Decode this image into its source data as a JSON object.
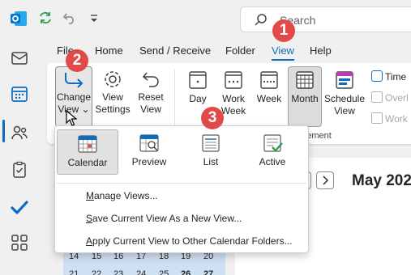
{
  "search": {
    "placeholder": "Search"
  },
  "menu": {
    "tabs": [
      {
        "label": "File"
      },
      {
        "label": "Home"
      },
      {
        "label": "Send / Receive"
      },
      {
        "label": "Folder"
      },
      {
        "label": "View",
        "active": true
      },
      {
        "label": "Help"
      }
    ]
  },
  "ribbon": {
    "change_view": {
      "line1": "Change",
      "line2": "View"
    },
    "view_settings": {
      "line1": "View",
      "line2": "Settings"
    },
    "reset_view": {
      "line1": "Reset",
      "line2": "View"
    },
    "day": "Day",
    "work_week": {
      "line1": "Work",
      "line2": "Week"
    },
    "week": "Week",
    "month": "Month",
    "schedule_view": {
      "line1": "Schedule",
      "line2": "View"
    },
    "time_scale": "Time",
    "overlay": "Overl",
    "work_hours": "Work",
    "group_label": "ngement"
  },
  "dropdown": {
    "views": [
      {
        "label": "Calendar",
        "icon": "calendar-view-icon",
        "selected": true
      },
      {
        "label": "Preview",
        "icon": "preview-view-icon"
      },
      {
        "label": "List",
        "icon": "list-view-icon"
      },
      {
        "label": "Active",
        "icon": "active-view-icon"
      }
    ],
    "items": [
      {
        "label": "Manage Views...",
        "accel": "M"
      },
      {
        "label": "Save Current View As a New View...",
        "accel": "S"
      },
      {
        "label": "Apply Current View to Other Calendar Folders...",
        "accel": "A"
      }
    ]
  },
  "calendar": {
    "month_title": "May 202"
  },
  "mini_calendar": {
    "row1": [
      "14",
      "15",
      "16",
      "17",
      "18",
      "19",
      "20"
    ],
    "row2": [
      "21",
      "22",
      "23",
      "24",
      "25",
      "26",
      "27"
    ]
  },
  "callouts": [
    "1",
    "2",
    "3"
  ],
  "colors": {
    "accent": "#0f6cbd",
    "callout": "#e24a4a",
    "outlook_blue": "#0078d4",
    "sync_green": "#2e9e4e"
  }
}
